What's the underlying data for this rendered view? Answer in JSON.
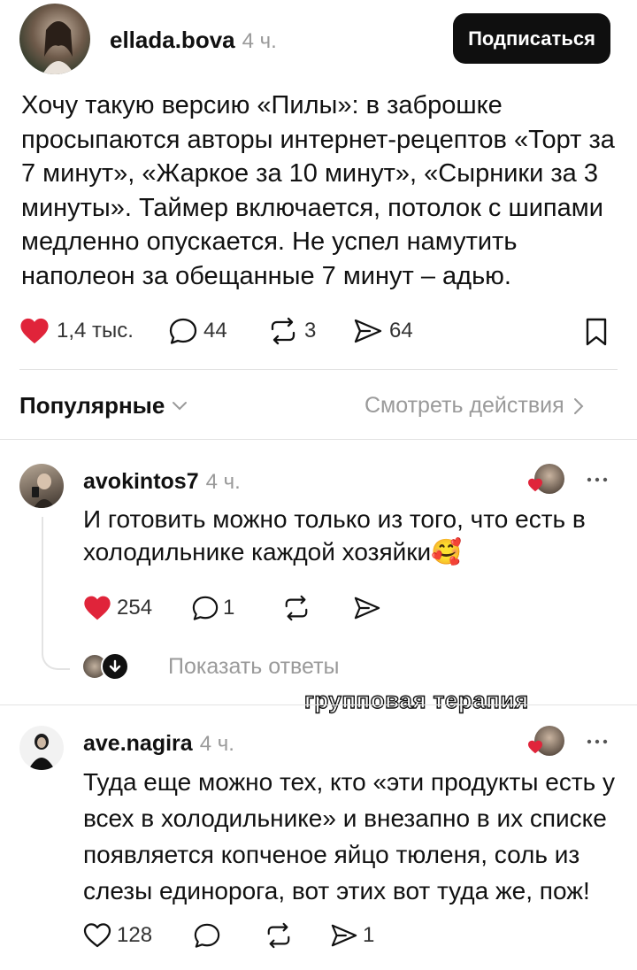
{
  "post": {
    "username": "ellada.bova",
    "time": "4 ч.",
    "follow_label": "Подписаться",
    "text_lines": [
      "Хочу такую версию «Пилы»: в заброшке",
      "просыпаются авторы интернет-рецептов «Торт за",
      "7 минут», «Жаркое за 10 минут», «Сырники за 3",
      "минуты». Таймер включается, потолок с шипами",
      "медленно опускается. Не успел намутить",
      "наполеон за обещанные 7 минут – адью."
    ],
    "likes": "1,4 тыс.",
    "comments": "44",
    "reposts": "3",
    "shares": "64"
  },
  "sort": {
    "label": "Популярные",
    "activity_label": "Смотреть действия"
  },
  "comments": [
    {
      "username": "avokintos7",
      "time": "4 ч.",
      "text_lines": [
        "И готовить можно только из того, что есть в",
        "холодильнике каждой хозяйки🥰"
      ],
      "likes": "254",
      "replies": "1",
      "show_replies_label": "Показать ответы"
    },
    {
      "username": "ave.nagira",
      "time": "4 ч.",
      "text_lines": [
        "Туда еще можно тех, кто «эти продукты есть у",
        "всех в холодильнике» и внезапно в их списке",
        "появляется копченое яйцо тюленя, соль из",
        "слезы единорога, вот этих вот туда же, пож!"
      ],
      "likes": "128",
      "shares": "1"
    }
  ],
  "watermark": "групповая терапия",
  "colors": {
    "like_red": "#e0243a",
    "muted_gray": "#9a9a9a",
    "button_black": "#0f0f0f"
  }
}
